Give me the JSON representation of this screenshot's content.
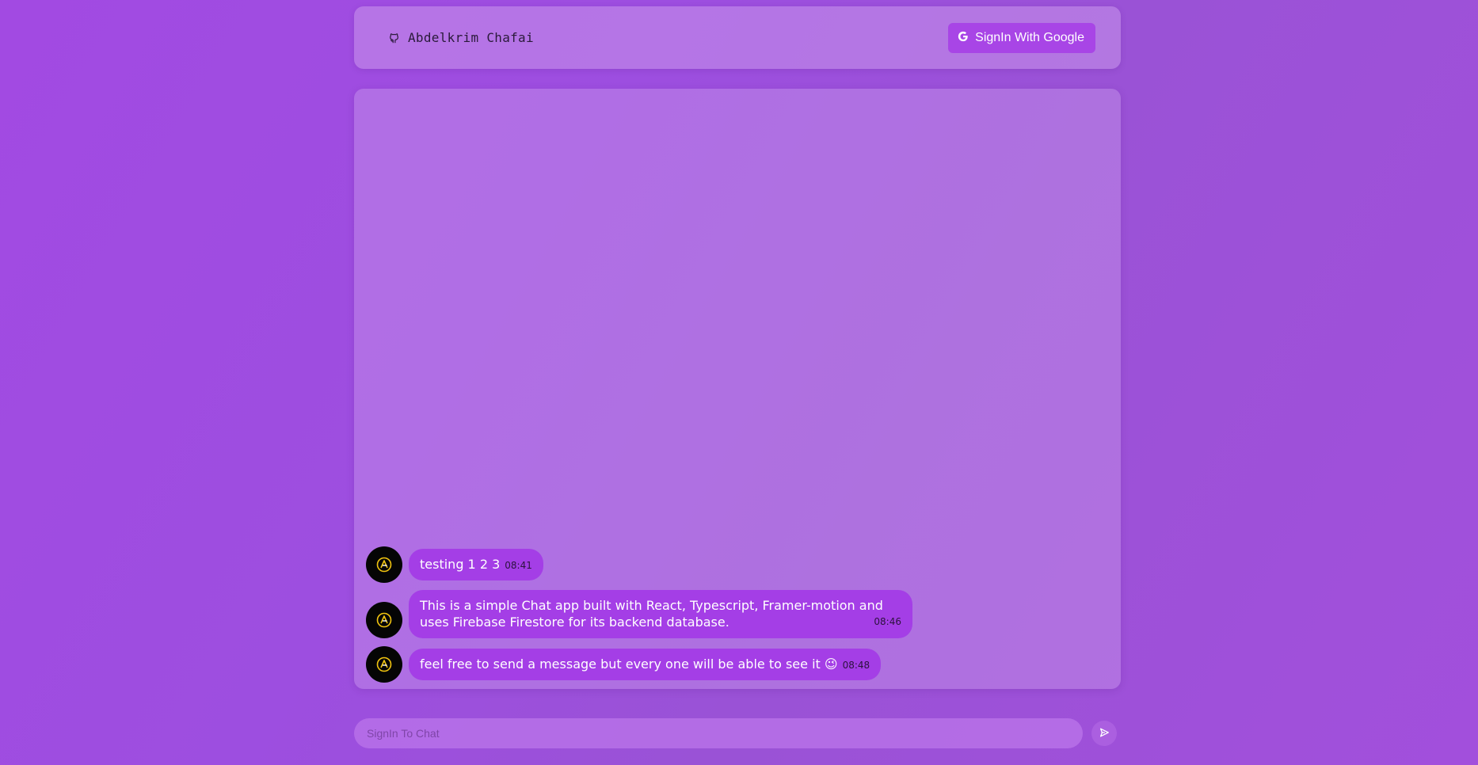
{
  "header": {
    "brand_name": "Abdelkrim Chafai",
    "brand_icon": "github-icon",
    "signin_label": "SignIn With Google",
    "signin_icon": "google-icon"
  },
  "messages": [
    {
      "text": "testing 1 2 3",
      "time": "08:41",
      "avatar": "user-avatar"
    },
    {
      "text": "This is a simple Chat app built with React, Typescript, Framer-motion and uses Firebase Firestore for its backend database.",
      "time": "08:46",
      "avatar": "user-avatar"
    },
    {
      "text": "feel free to send a message but every one will be able to see it 😉",
      "time": "08:48",
      "avatar": "user-avatar"
    }
  ],
  "composer": {
    "placeholder": "SignIn To Chat",
    "send_icon": "send-icon"
  },
  "colors": {
    "accent": "#a845e6",
    "bubble": "#a43ee6",
    "avatar_bg": "#050505"
  }
}
